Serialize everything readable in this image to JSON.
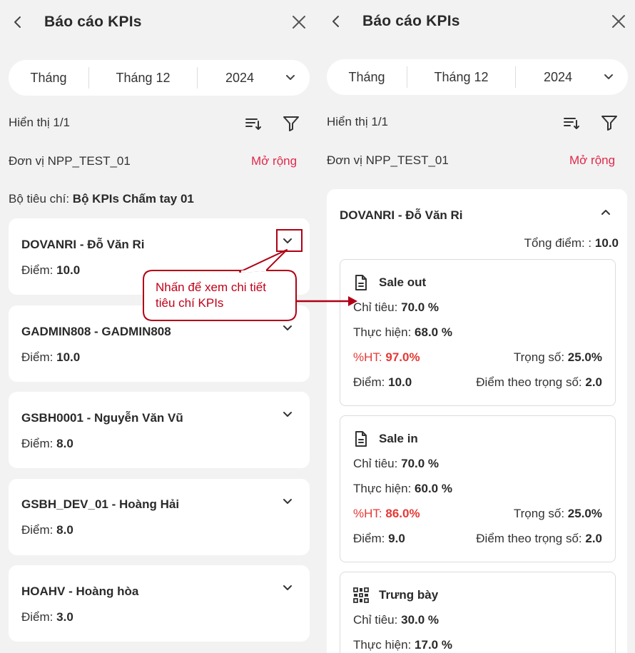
{
  "header": {
    "title": "Báo cáo KPIs"
  },
  "filter": {
    "period_type": "Tháng",
    "month": "Tháng 12",
    "year": "2024"
  },
  "showing": "Hiển thị 1/1",
  "unit": "Đơn vị NPP_TEST_01",
  "expand_label": "Mở rộng",
  "criteria": {
    "label": "Bộ tiêu chí:",
    "value": "Bộ KPIs Chấm tay 01"
  },
  "score_label": "Điểm:",
  "employees": [
    {
      "name": "DOVANRI - Đỗ Văn Ri",
      "score": "10.0"
    },
    {
      "name": "GADMIN808 - GADMIN808",
      "score": "10.0"
    },
    {
      "name": "GSBH0001 - Nguyễn Văn Vũ",
      "score": "8.0"
    },
    {
      "name": "GSBH_DEV_01 - Hoàng Hải",
      "score": "8.0"
    },
    {
      "name": "HOAHV - Hoàng hòa",
      "score": "3.0"
    }
  ],
  "callout": {
    "line1": "Nhấn để xem chi tiết",
    "line2": "tiêu chí KPIs"
  },
  "detail": {
    "name": "DOVANRI - Đỗ Văn Ri",
    "total_label": "Tổng điểm: :",
    "total_value": "10.0",
    "labels": {
      "target": "Chỉ tiêu:",
      "actual": "Thực hiện:",
      "pct": "%HT:",
      "weight": "Trọng số:",
      "score": "Điểm:",
      "weighted": "Điểm theo trọng số:"
    },
    "kpis": [
      {
        "title": "Sale out",
        "icon": "document-icon",
        "target": "70.0 %",
        "actual": "68.0 %",
        "pct": "97.0%",
        "weight": "25.0%",
        "score": "10.0",
        "weighted": "2.0"
      },
      {
        "title": "Sale in",
        "icon": "document-icon",
        "target": "70.0 %",
        "actual": "60.0 %",
        "pct": "86.0%",
        "weight": "25.0%",
        "score": "9.0",
        "weighted": "2.0"
      },
      {
        "title": "Trưng bày",
        "icon": "grid-icon",
        "target": "30.0 %",
        "actual": "17.0 %"
      }
    ]
  },
  "colors": {
    "accent": "#e0294a",
    "pct_red": "#e53935",
    "callout_red": "#c00018",
    "background": "#f2f2f2"
  }
}
